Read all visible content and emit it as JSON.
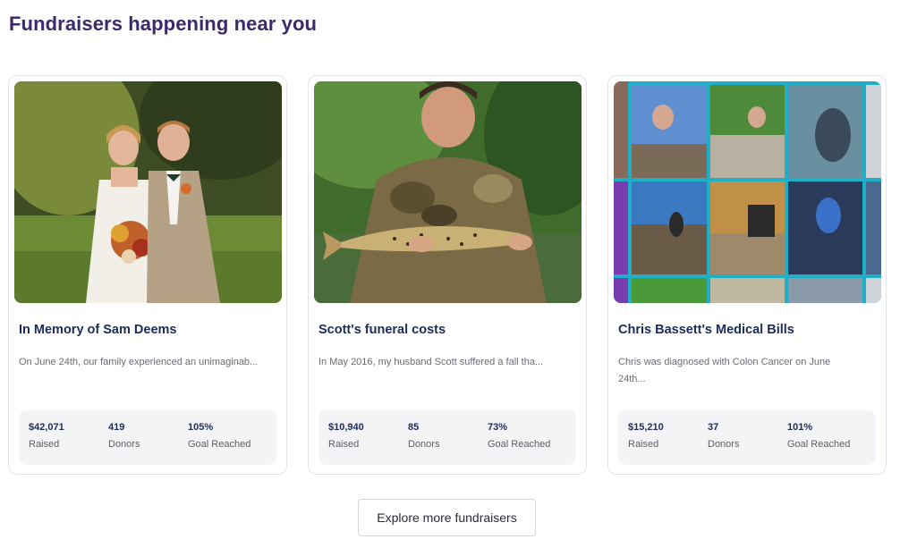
{
  "section": {
    "title": "Fundraisers happening near you"
  },
  "cards": [
    {
      "image": "wedding-photo",
      "title": "In Memory of Sam Deems",
      "description": "On June 24th, our family experienced an unimaginab...",
      "stats": {
        "raised": "$42,071",
        "raised_label": "Raised",
        "donors": "419",
        "donors_label": "Donors",
        "goal": "105%",
        "goal_label": "Goal Reached"
      }
    },
    {
      "image": "fishing-photo",
      "title": "Scott's funeral costs",
      "description": "In May 2016, my husband Scott  suffered a fall tha...",
      "stats": {
        "raised": "$10,940",
        "raised_label": "Raised",
        "donors": "85",
        "donors_label": "Donors",
        "goal": "73%",
        "goal_label": "Goal Reached"
      }
    },
    {
      "image": "photo-collage",
      "title": "Chris Bassett's Medical Bills",
      "description": "Chris was diagnosed with Colon Cancer on June 24th...",
      "stats": {
        "raised": "$15,210",
        "raised_label": "Raised",
        "donors": "37",
        "donors_label": "Donors",
        "goal": "101%",
        "goal_label": "Goal Reached"
      }
    }
  ],
  "explore": {
    "label": "Explore more fundraisers"
  },
  "colors": {
    "title": "#3a2a6b",
    "card_title": "#1d2b5a",
    "collage_border": "#1fb0c8"
  }
}
